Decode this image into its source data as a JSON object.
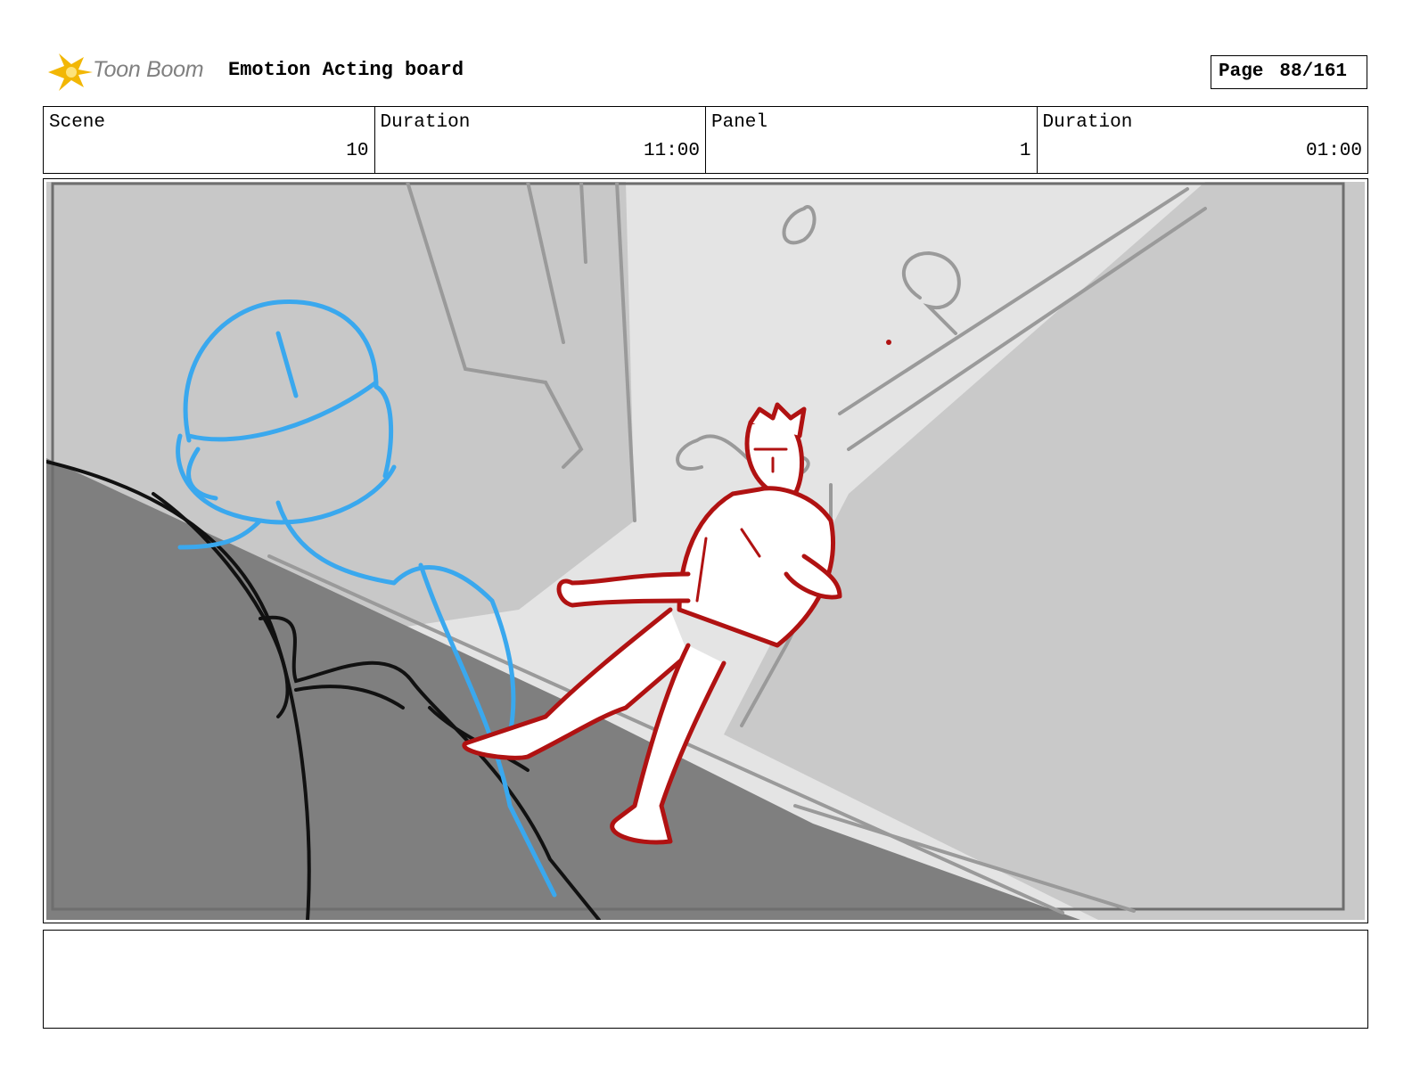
{
  "header": {
    "logo_text": "Toon Boom",
    "title": "Emotion Acting board",
    "page_label": "Page",
    "page_value": "88/161"
  },
  "info": {
    "scene_label": "Scene",
    "scene_value": "10",
    "scene_duration_label": "Duration",
    "scene_duration_value": "11:00",
    "panel_label": "Panel",
    "panel_value": "1",
    "panel_duration_label": "Duration",
    "panel_duration_value": "01:00"
  },
  "notes": {
    "text": ""
  },
  "colors": {
    "character_foreground": "#3aa8ee",
    "character_main": "#b01212",
    "sketch_lines": "#111111",
    "logo_accent": "#f2b705"
  }
}
